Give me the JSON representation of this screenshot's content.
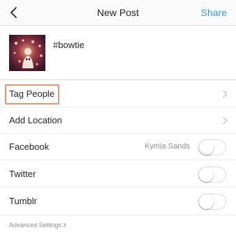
{
  "header": {
    "title": "New Post",
    "share_label": "Share",
    "back_icon": "chevron-left-icon"
  },
  "post": {
    "caption": "#bowtie"
  },
  "rows": {
    "tag_people": "Tag People",
    "add_location": "Add Location"
  },
  "share_targets": [
    {
      "label": "Facebook",
      "account": "Kymia Sands",
      "enabled": false
    },
    {
      "label": "Twitter",
      "enabled": false
    },
    {
      "label": "Tumblr",
      "enabled": false
    }
  ],
  "advanced": {
    "label": "Advanced Settings"
  },
  "colors": {
    "accent": "#3897f0",
    "highlight": "#f0916c",
    "border": "#dbdbdb",
    "muted": "#8e8e8e"
  }
}
